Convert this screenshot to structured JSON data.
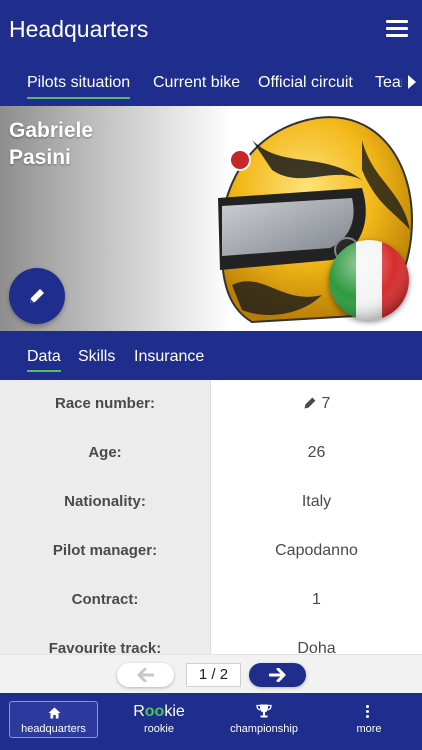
{
  "header": {
    "title": "Headquarters",
    "menu_icon": "hamburger-menu-icon"
  },
  "top_tabs": [
    {
      "label": "Pilots situation",
      "active": true
    },
    {
      "label": "Current bike",
      "active": false
    },
    {
      "label": "Official circuit",
      "active": false
    },
    {
      "label": "Team",
      "active": false
    }
  ],
  "hero": {
    "first_name": "Gabriele",
    "last_name": "Pasini",
    "edit_icon": "pencil-icon",
    "helmet_image": "yellow-racing-helmet",
    "flag": "italy-flag"
  },
  "sub_tabs": [
    {
      "label": "Data",
      "active": true
    },
    {
      "label": "Skills",
      "active": false
    },
    {
      "label": "Insurance",
      "active": false
    }
  ],
  "data_rows": [
    {
      "label": "Race number:",
      "value": "7",
      "editable": true
    },
    {
      "label": "Age:",
      "value": "26"
    },
    {
      "label": "Nationality:",
      "value": "Italy"
    },
    {
      "label": "Pilot manager:",
      "value": "Capodanno"
    },
    {
      "label": "Contract:",
      "value": "1"
    },
    {
      "label": "Favourite track:",
      "value": "Doha"
    }
  ],
  "pager": {
    "count": "1 / 2",
    "prev_icon": "arrow-left-icon",
    "next_icon": "arrow-right-icon"
  },
  "bottom_nav": {
    "home": {
      "label": "headquarters",
      "icon": "home-icon"
    },
    "rookie": {
      "label": "rookie",
      "logo_r": "R",
      "logo_oo": "oo",
      "logo_kie": "kie"
    },
    "championship": {
      "label": "championship",
      "icon": "trophy-icon"
    },
    "more": {
      "label": "more",
      "icon": "vertical-dots-icon"
    }
  },
  "colors": {
    "primary": "#1f2d8c",
    "accent": "#4fc15a",
    "helmet_yellow": "#f2b818"
  }
}
